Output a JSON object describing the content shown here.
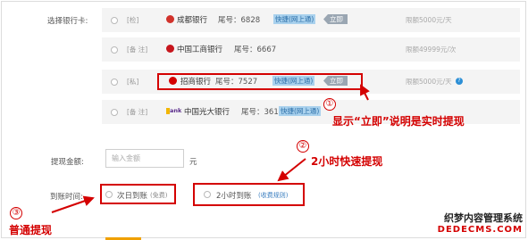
{
  "form": {
    "bank_label": "选择银行卡:",
    "amount_label": "提现金额:",
    "amount_placeholder": "输入金额",
    "amount_unit": "元",
    "arrival_label": "到账时间:"
  },
  "banks": [
    {
      "tag": "[检]",
      "name": "成都银行",
      "tail": "尾号：6828",
      "quick": "快捷(网上通)",
      "badge": "立即",
      "limit": "限额5000元/天",
      "icon_color": "#d1322b"
    },
    {
      "tag": "[备 注]",
      "name": "中国工商银行",
      "tail": "尾号：6667",
      "quick": "",
      "badge": "",
      "limit": "限额49999元/次",
      "icon_color": "#c7161d"
    },
    {
      "tag": "[私]",
      "name": "招商银行",
      "tail": "尾号：7527",
      "quick": "快捷(网上通)",
      "badge": "立即",
      "limit": "限额5000元/天",
      "icon_color": "#d40000",
      "help": "?"
    },
    {
      "tag": "[备 注]",
      "name": "中国光大银行",
      "tail": "尾号：3615",
      "quick": "快捷(网上通)",
      "badge": "",
      "limit": "",
      "icon_color": "#5b2c8a",
      "icon_text": "ank"
    }
  ],
  "arrival_options": [
    {
      "label": "次日到账",
      "note": "(免费)"
    },
    {
      "label": "2小时到账",
      "note": "(收费规则)"
    }
  ],
  "annotations": {
    "a1_num": "①",
    "a1_text": "显示“立即”说明是实时提现",
    "a2_num": "②",
    "a2_text": "2小时快速提现",
    "a3_num": "③",
    "a3_text": "普通提现"
  },
  "watermark": {
    "line1": "织梦内容管理系统",
    "line2": "DEDECMS.COM"
  },
  "colors": {
    "annotation_red": "#d40000",
    "quick_bg": "#a9d1ed",
    "row_bg": "#f4f4f4"
  }
}
